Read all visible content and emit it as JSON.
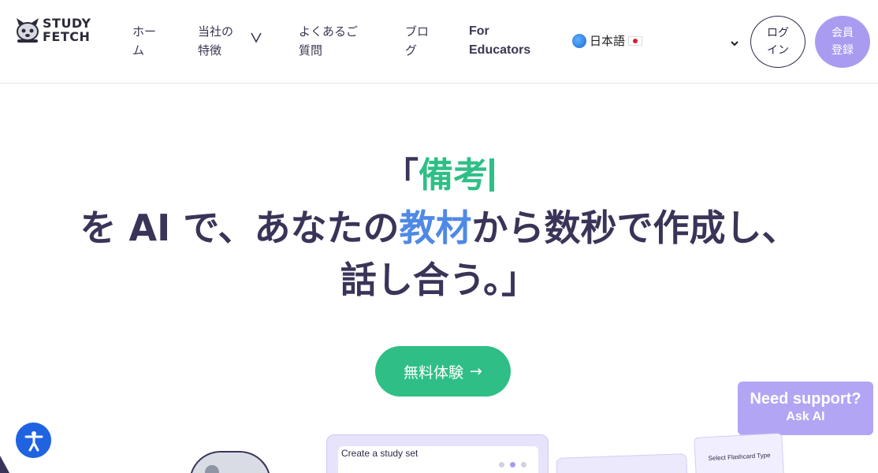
{
  "brand": {
    "line1": "STUDY",
    "line2": "FETCH"
  },
  "nav": {
    "home": "ホーム",
    "features": "当社の特徴",
    "faq": "よくあるご質問",
    "blog": "ブログ",
    "educators": "For Educators",
    "language": "日本語",
    "login": "ログイン",
    "signup": "会員登録"
  },
  "hero": {
    "open_bracket": "「",
    "typed_word": "備考",
    "line2_part1": "を AI で、あなたの",
    "line2_highlight": "教材",
    "line2_part2": "から数秒で作成し、",
    "line3": "話し合う。」"
  },
  "cta": {
    "label": "無料体験",
    "arrow": "→"
  },
  "support": {
    "title": "Need support?",
    "subtitle": "Ask AI"
  },
  "preview": {
    "card_title": "Create a study set",
    "side_label": "Select Flashcard Type"
  },
  "colors": {
    "accent_green": "#2fbf86",
    "accent_blue": "#4f89e6",
    "accent_purple": "#a99cf0",
    "text_dark": "#3a3458",
    "accessibility_blue": "#1f63e0"
  },
  "icons": {
    "features_dropdown": "chevron-down-icon",
    "language_dropdown": "chevron-down-icon",
    "globe": "globe-icon",
    "flag": "japan-flag-icon",
    "accessibility": "accessibility-icon"
  }
}
